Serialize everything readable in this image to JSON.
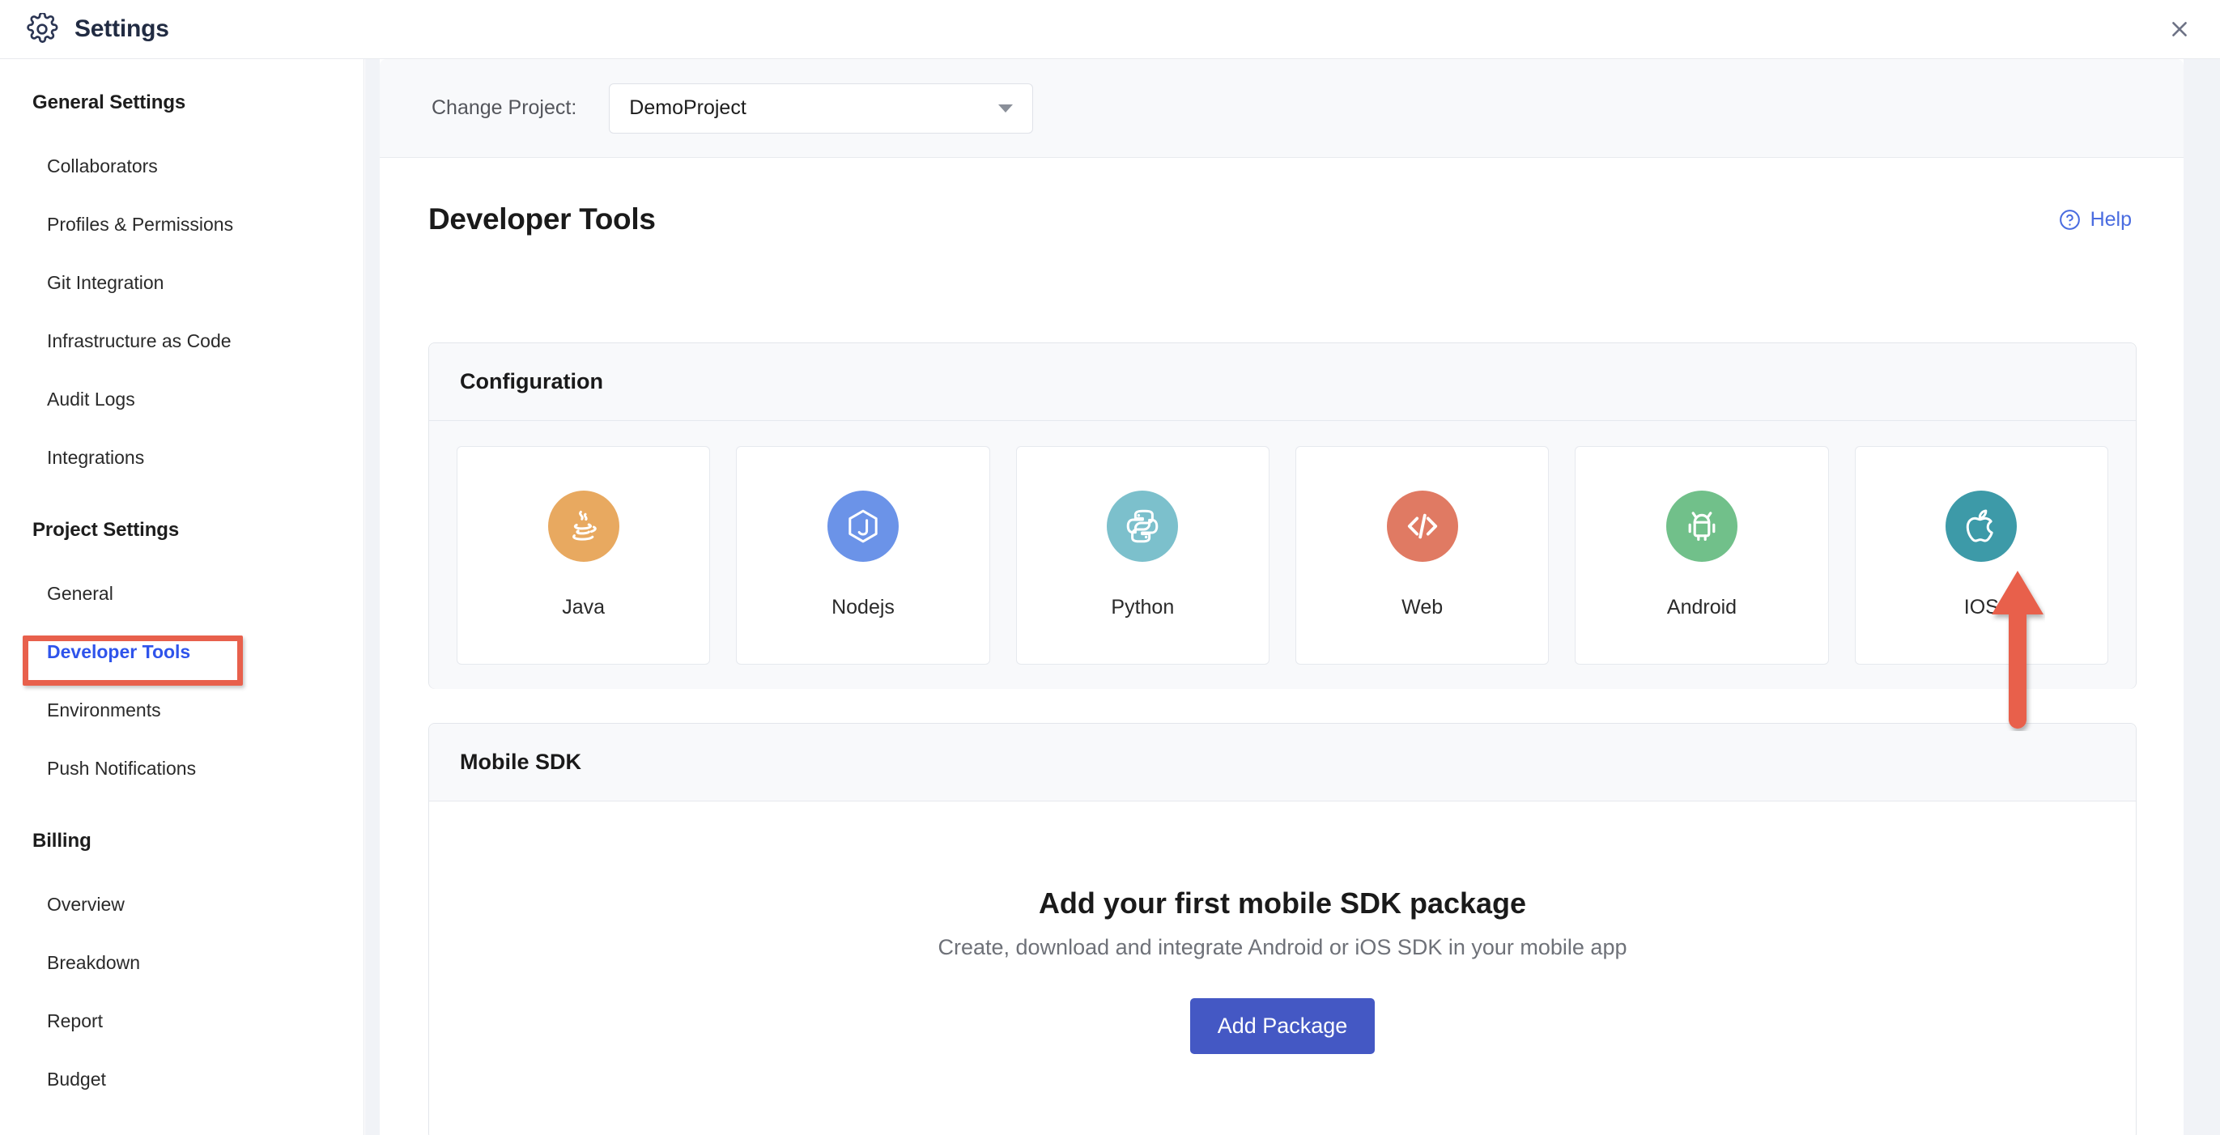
{
  "header": {
    "title": "Settings",
    "gear_icon": "gear-icon",
    "close_icon": "close-icon"
  },
  "sidebar": {
    "groups": [
      {
        "title": "General Settings",
        "items": [
          {
            "label": "Collaborators",
            "active": false
          },
          {
            "label": "Profiles & Permissions",
            "active": false
          },
          {
            "label": "Git Integration",
            "active": false
          },
          {
            "label": "Infrastructure as Code",
            "active": false
          },
          {
            "label": "Audit Logs",
            "active": false
          },
          {
            "label": "Integrations",
            "active": false
          }
        ]
      },
      {
        "title": "Project Settings",
        "items": [
          {
            "label": "General",
            "active": false
          },
          {
            "label": "Developer Tools",
            "active": true
          },
          {
            "label": "Environments",
            "active": false
          },
          {
            "label": "Push Notifications",
            "active": false
          }
        ]
      },
      {
        "title": "Billing",
        "items": [
          {
            "label": "Overview",
            "active": false
          },
          {
            "label": "Breakdown",
            "active": false
          },
          {
            "label": "Report",
            "active": false
          },
          {
            "label": "Budget",
            "active": false
          }
        ]
      }
    ]
  },
  "project_bar": {
    "label": "Change Project:",
    "selected": "DemoProject",
    "caret_icon": "chevron-down-icon"
  },
  "page": {
    "title": "Developer Tools",
    "help_label": "Help",
    "help_icon": "question-circle-icon"
  },
  "configuration": {
    "title": "Configuration",
    "cards": [
      {
        "label": "Java",
        "icon": "java-icon",
        "color": "#e8a960"
      },
      {
        "label": "Nodejs",
        "icon": "nodejs-icon",
        "color": "#6b93e8"
      },
      {
        "label": "Python",
        "icon": "python-icon",
        "color": "#7cc0cc"
      },
      {
        "label": "Web",
        "icon": "code-icon",
        "color": "#e07a63"
      },
      {
        "label": "Android",
        "icon": "android-icon",
        "color": "#71c08a"
      },
      {
        "label": "IOS",
        "icon": "apple-icon",
        "color": "#3d9aa8"
      }
    ]
  },
  "mobile_sdk": {
    "title": "Mobile SDK",
    "empty_title": "Add your first mobile SDK package",
    "empty_subtitle": "Create, download and integrate Android or iOS SDK in your mobile app",
    "add_button": "Add Package",
    "button_color": "#4458c4"
  },
  "annotations": {
    "highlight_color": "#e8604c",
    "highlight_target": "Developer Tools",
    "arrow_color": "#e8604c",
    "arrow_target": "IOS"
  }
}
